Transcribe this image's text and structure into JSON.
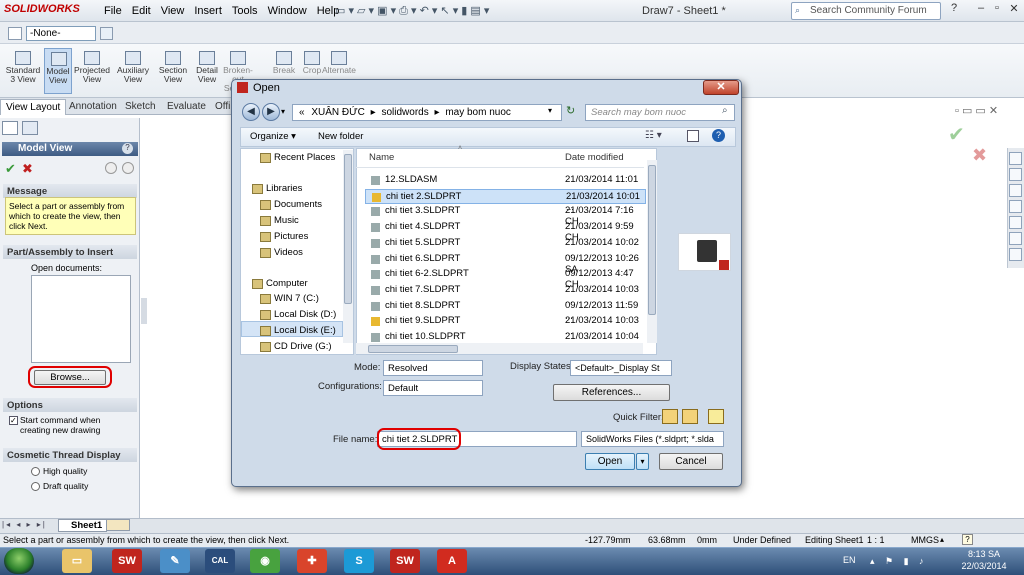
{
  "app": {
    "logo": "SOLIDWORKS",
    "menu": [
      "File",
      "Edit",
      "View",
      "Insert",
      "Tools",
      "Window",
      "Help"
    ],
    "window_title": "Draw7 - Sheet1 *",
    "search_placeholder": "Search Community Forum",
    "question": "?",
    "config_combo": "-None-"
  },
  "ribbon": [
    {
      "label": "Standard 3 View",
      "active": false
    },
    {
      "label": "Model View",
      "active": true
    },
    {
      "label": "Projected View",
      "active": false
    },
    {
      "label": "Auxiliary View",
      "active": false
    },
    {
      "label": "Section View",
      "active": false
    },
    {
      "label": "Detail View",
      "active": false
    },
    {
      "label": "Broken-out Section",
      "active": false
    },
    {
      "label": "Break",
      "active": false
    },
    {
      "label": "Crop",
      "active": false
    },
    {
      "label": "Alternate",
      "active": false
    }
  ],
  "tabs": [
    "View Layout",
    "Annotation",
    "Sketch",
    "Evaluate",
    "Offi"
  ],
  "property_manager": {
    "title": "Model View",
    "message_head": "Message",
    "message": "Select a part or assembly from which to create the view, then click Next.",
    "part_head": "Part/Assembly to Insert",
    "open_docs": "Open documents:",
    "browse": "Browse...",
    "options_head": "Options",
    "start_cmd": "Start command when creating new drawing",
    "cosmetic_head": "Cosmetic Thread Display",
    "high_quality": "High quality",
    "draft_quality": "Draft quality"
  },
  "sheet_tab": "Sheet1",
  "status": {
    "hint": "Select a part or assembly from which to create the view, then click Next.",
    "x": "-127.79mm",
    "y": "63.68mm",
    "z": "0mm",
    "state": "Under Defined",
    "editing": "Editing Sheet1",
    "scale": "1 : 1",
    "units": "MMGS",
    "help": "?"
  },
  "taskbar": {
    "lang": "EN",
    "time": "8:13 SA",
    "date": "22/03/2014",
    "icons": [
      "start-orb",
      "folder",
      "solidworks",
      "paint",
      "calc",
      "chrome",
      "shield",
      "skype",
      "solidworks-2",
      "acrobat"
    ]
  },
  "dialog": {
    "title": "Open",
    "path": [
      "«",
      "XUÂN ĐỨC",
      "solidwords",
      "may bom nuoc"
    ],
    "search_placeholder": "Search may bom nuoc",
    "organize": "Organize ▾",
    "new_folder": "New folder",
    "nav": [
      {
        "label": "Recent Places",
        "kind": "item"
      },
      {
        "label": "Libraries",
        "kind": "group"
      },
      {
        "label": "Documents",
        "kind": "item"
      },
      {
        "label": "Music",
        "kind": "item"
      },
      {
        "label": "Pictures",
        "kind": "item"
      },
      {
        "label": "Videos",
        "kind": "item"
      },
      {
        "label": "Computer",
        "kind": "group"
      },
      {
        "label": "WIN 7 (C:)",
        "kind": "item"
      },
      {
        "label": "Local Disk (D:)",
        "kind": "item"
      },
      {
        "label": "Local Disk (E:)",
        "kind": "item"
      },
      {
        "label": "CD Drive (G:)",
        "kind": "item"
      }
    ],
    "col_name": "Name",
    "col_date": "Date modified",
    "files": [
      {
        "name": "12.SLDASM",
        "date": "21/03/2014 11:01 ..."
      },
      {
        "name": "chi tiet 2.SLDPRT",
        "date": "21/03/2014 10:01 ..."
      },
      {
        "name": "chi tiet 3.SLDPRT",
        "date": "21/03/2014 7:16 CH"
      },
      {
        "name": "chi tiet 4.SLDPRT",
        "date": "21/03/2014 9:59 CH"
      },
      {
        "name": "chi tiet 5.SLDPRT",
        "date": "21/03/2014 10:02 ..."
      },
      {
        "name": "chi tiet 6.SLDPRT",
        "date": "09/12/2013 10:26 SA"
      },
      {
        "name": "chi tiet 6-2.SLDPRT",
        "date": "09/12/2013 4:47 CH"
      },
      {
        "name": "chi tiet 7.SLDPRT",
        "date": "21/03/2014 10:03 ..."
      },
      {
        "name": "chi tiet 8.SLDPRT",
        "date": "09/12/2013 11:59 ..."
      },
      {
        "name": "chi tiet 9.SLDPRT",
        "date": "21/03/2014 10:03 ..."
      },
      {
        "name": "chi tiet 10.SLDPRT",
        "date": "21/03/2014 10:04 ..."
      }
    ],
    "selected_index": 1,
    "mode_label": "Mode:",
    "mode_value": "Resolved",
    "config_label": "Configurations:",
    "config_value": "Default",
    "display_label": "Display States:",
    "display_value": "<Default>_Display St",
    "references": "References...",
    "quick_filter": "Quick Filter:",
    "filename_label": "File name:",
    "filename_value": "chi tiet 2.SLDPRT",
    "filetype": "SolidWorks Files (*.sldprt; *.slda",
    "open": "Open",
    "cancel": "Cancel"
  }
}
